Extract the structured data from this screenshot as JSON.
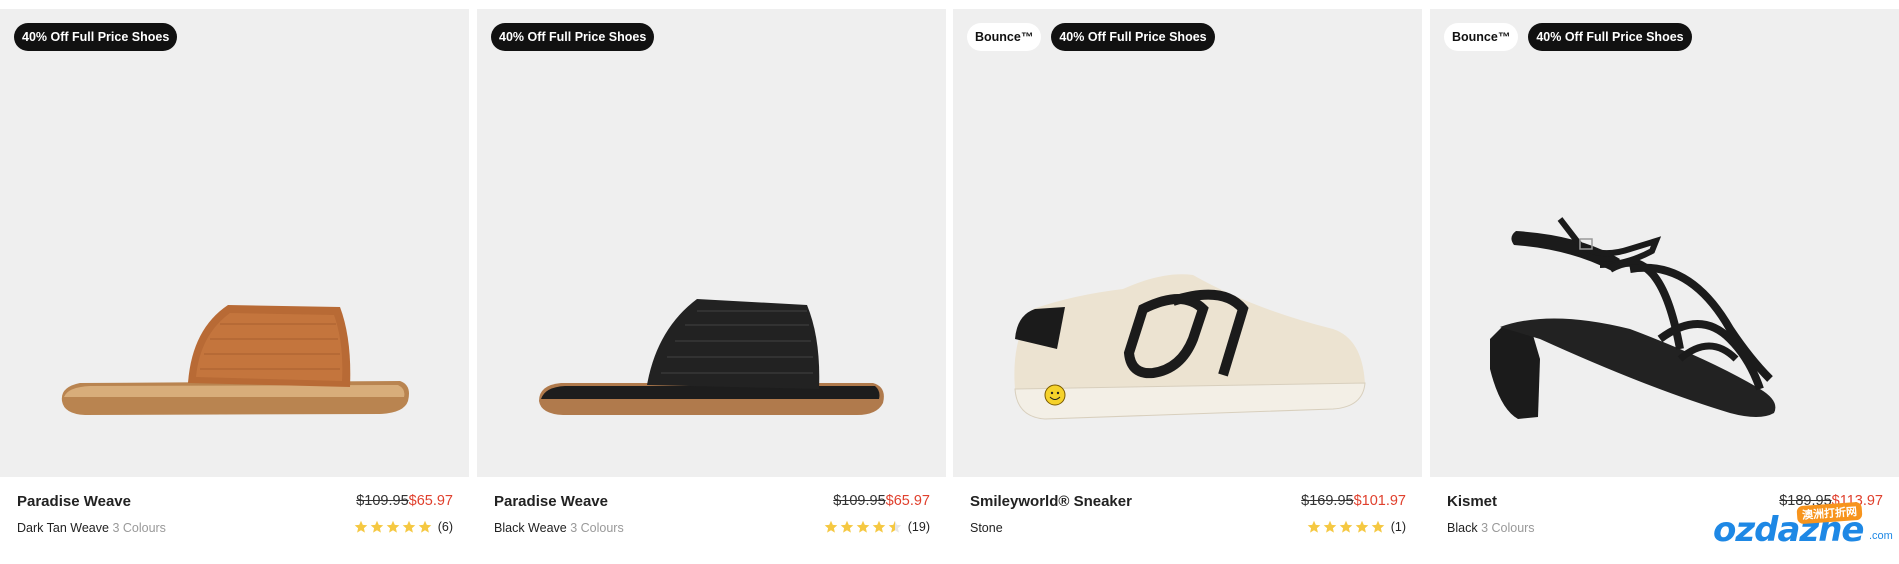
{
  "products": [
    {
      "badges": [
        {
          "label": "40% Off Full Price Shoes",
          "style": "dark"
        }
      ],
      "name": "Paradise Weave",
      "price_old": "$109.95",
      "price_new": "$65.97",
      "colour": "Dark Tan Weave",
      "colour_count": "3 Colours",
      "rating_stars": 5,
      "rating_count": "(6)",
      "image": "tan-woven-slide-sandal"
    },
    {
      "badges": [
        {
          "label": "40% Off Full Price Shoes",
          "style": "dark"
        }
      ],
      "name": "Paradise Weave",
      "price_old": "$109.95",
      "price_new": "$65.97",
      "colour": "Black Weave",
      "colour_count": "3 Colours",
      "rating_stars": 4.5,
      "rating_count": "(19)",
      "image": "black-woven-slide-sandal"
    },
    {
      "badges": [
        {
          "label": "Bounce™",
          "style": "light"
        },
        {
          "label": "40% Off Full Price Shoes",
          "style": "dark"
        }
      ],
      "name": "Smileyworld® Sneaker",
      "price_old": "$169.95",
      "price_new": "$101.97",
      "colour": "Stone",
      "colour_count": "",
      "rating_stars": 5,
      "rating_count": "(1)",
      "image": "stone-sneaker-smiley"
    },
    {
      "badges": [
        {
          "label": "Bounce™",
          "style": "light"
        },
        {
          "label": "40% Off Full Price Shoes",
          "style": "dark"
        }
      ],
      "name": "Kismet",
      "price_old": "$189.95",
      "price_new": "$113.97",
      "colour": "Black",
      "colour_count": "3 Colours",
      "rating_stars": 0,
      "rating_count": "",
      "image": "black-block-heel-sandal"
    }
  ],
  "colors": {
    "sale": "#e0402d",
    "star": "#f5c842",
    "card_bg": "#efefef"
  },
  "watermark": {
    "text": "ozdazhe",
    "suffix": ".com",
    "tag": "澳洲打折网"
  }
}
